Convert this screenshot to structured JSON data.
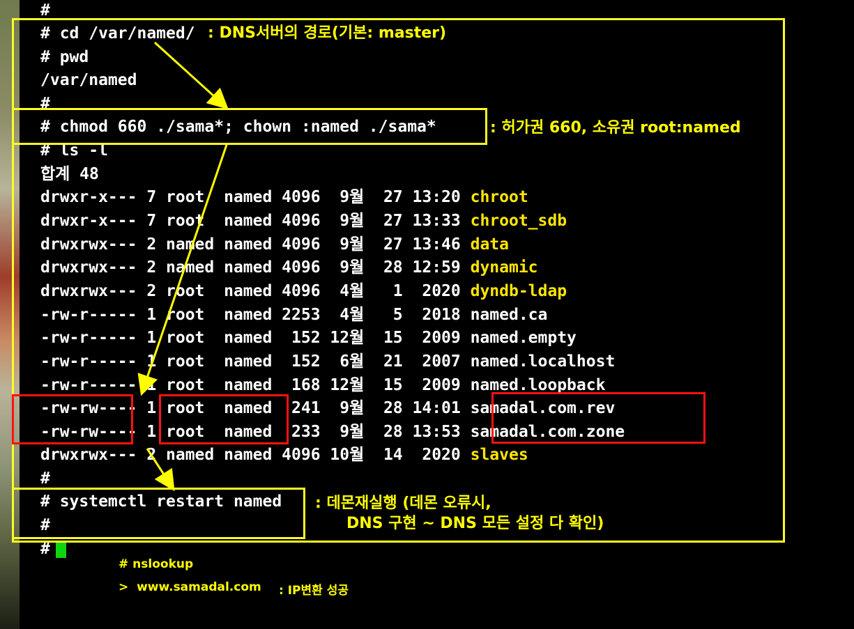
{
  "terminal": {
    "lines": [
      {
        "prefix": "#",
        "name": ""
      },
      {
        "prefix": "# cd /var/named/",
        "name": ""
      },
      {
        "prefix": "# pwd",
        "name": ""
      },
      {
        "prefix": "/var/named",
        "name": ""
      },
      {
        "prefix": "#",
        "name": ""
      },
      {
        "prefix": "# chmod 660 ./sama*; chown :named ./sama*",
        "name": ""
      },
      {
        "prefix": "# ls -l",
        "name": ""
      },
      {
        "prefix": "합계 48",
        "name": ""
      },
      {
        "prefix": "drwxr-x--- 7 root  named 4096  9월  27 13:20 ",
        "name": "chroot"
      },
      {
        "prefix": "drwxr-x--- 7 root  named 4096  9월  27 13:33 ",
        "name": "chroot_sdb"
      },
      {
        "prefix": "drwxrwx--- 2 named named 4096  9월  27 13:46 ",
        "name": "data"
      },
      {
        "prefix": "drwxrwx--- 2 named named 4096  9월  28 12:59 ",
        "name": "dynamic"
      },
      {
        "prefix": "drwxrwx--- 2 root  named 4096  4월   1  2020 ",
        "name": "dyndb-ldap"
      },
      {
        "prefix": "-rw-r----- 1 root  named 2253  4월   5  2018 named.ca",
        "name": ""
      },
      {
        "prefix": "-rw-r----- 1 root  named  152 12월  15  2009 named.empty",
        "name": ""
      },
      {
        "prefix": "-rw-r----- 1 root  named  152  6월  21  2007 named.localhost",
        "name": ""
      },
      {
        "prefix": "-rw-r----- 1 root  named  168 12월  15  2009 named.loopback",
        "name": ""
      },
      {
        "prefix": "-rw-rw---- 1 root  named  241  9월  28 14:01 samadal.com.rev",
        "name": ""
      },
      {
        "prefix": "-rw-rw---- 1 root  named  233  9월  28 13:53 samadal.com.zone",
        "name": ""
      },
      {
        "prefix": "drwxrwx--- 2 named named 4096 10월  14  2020 ",
        "name": "slaves"
      },
      {
        "prefix": "#",
        "name": ""
      },
      {
        "prefix": "# systemctl restart named",
        "name": ""
      },
      {
        "prefix": "#",
        "name": ""
      },
      {
        "prefix": "#",
        "name": ""
      }
    ]
  },
  "annotations": {
    "dns_path": ": DNS서버의 경로(기본: master)",
    "permission": ": 허가권 660, 소유권 root:named",
    "restart_line1": ": 데몬재실행 (데몬 오류시,",
    "restart_line2": "DNS 구현 ~ DNS 모든 설정 다 확인)",
    "nslookup_cmd": "# nslookup",
    "nslookup_query": ">  www.samadal.com",
    "nslookup_result": ": IP변환 성공"
  },
  "colors": {
    "background": "#000000",
    "text": "#ffffff",
    "directory_name": "#ffe600",
    "annotation": "#ffff00",
    "highlight_box_yellow": "#ffff22",
    "highlight_box_red": "#ff1212",
    "cursor": "#11d411"
  }
}
